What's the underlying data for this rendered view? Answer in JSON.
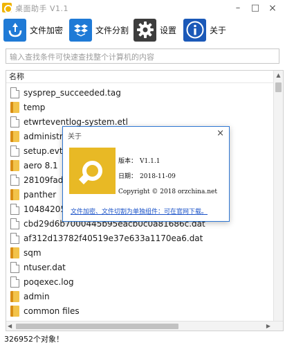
{
  "window": {
    "title": "桌面助手 V1.1",
    "minimize": "–",
    "maximize": "□",
    "close": "×"
  },
  "toolbar": {
    "encrypt_label": "文件加密",
    "split_label": "文件分割",
    "settings_label": "设置",
    "about_label": "关于"
  },
  "search": {
    "placeholder": "输入查找条件可快速查找整个计算机的内容"
  },
  "list": {
    "header": "名称",
    "items": [
      {
        "name": "sysprep_succeeded.tag",
        "kind": "file"
      },
      {
        "name": "temp",
        "kind": "folder"
      },
      {
        "name": "etwrteventlog-system.etl",
        "kind": "file"
      },
      {
        "name": "administr",
        "kind": "folder"
      },
      {
        "name": "setup.evtx",
        "kind": "file"
      },
      {
        "name": "aero 8.1",
        "kind": "folder"
      },
      {
        "name": "28109fad",
        "kind": "file"
      },
      {
        "name": "panther",
        "kind": "folder"
      },
      {
        "name": "10484205",
        "kind": "file"
      },
      {
        "name": "cbd29d6b7000445b95eacb0c0a81686c.dat",
        "kind": "file"
      },
      {
        "name": "af312d13782f40519e37e633a1170ea6.dat",
        "kind": "file"
      },
      {
        "name": "sqm",
        "kind": "folder"
      },
      {
        "name": "ntuser.dat",
        "kind": "file"
      },
      {
        "name": "poqexec.log",
        "kind": "file"
      },
      {
        "name": "admin",
        "kind": "folder"
      },
      {
        "name": "common files",
        "kind": "folder"
      }
    ]
  },
  "status": {
    "text": "326952个对象！"
  },
  "about_dialog": {
    "title": "关于",
    "close": "×",
    "version_label": "版本：",
    "version_value": "V1.1.1",
    "date_label": "日期：",
    "date_value": "2018-11-09",
    "copyright": "Copyright © 2018 orzchina.net",
    "link_text": "文件加密、文件切割为单独组件：可在官网下载。"
  },
  "colors": {
    "accent_blue": "#1f7ad6",
    "dialog_border": "#2e76d2",
    "logo_yellow": "#e8b925",
    "link": "#1a52c8"
  }
}
